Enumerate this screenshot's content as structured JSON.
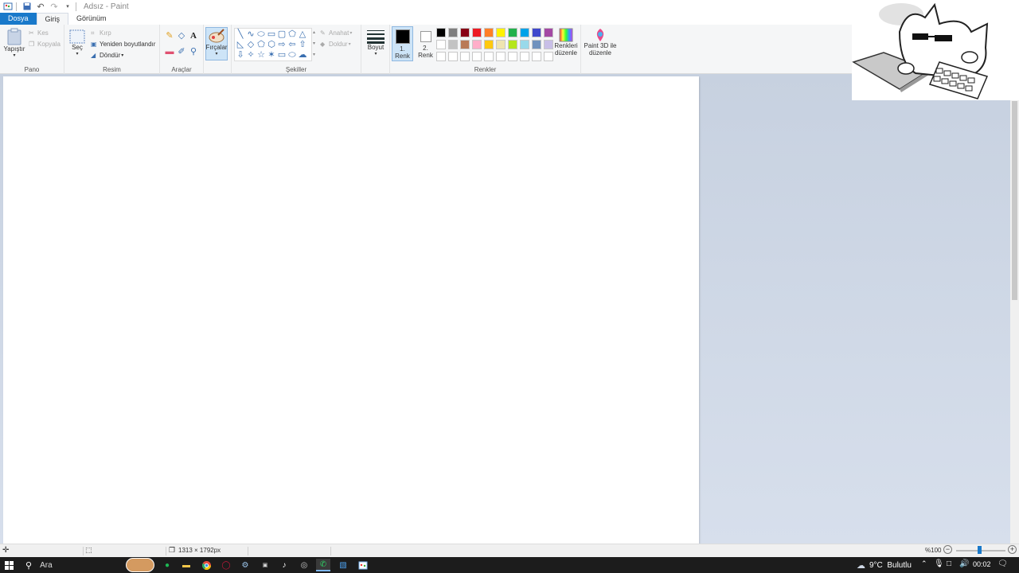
{
  "window": {
    "title": "Adsız - Paint",
    "quick_access": [
      "paint-app-icon",
      "save-icon",
      "undo-icon",
      "redo-icon",
      "customize-dropdown-icon"
    ]
  },
  "tabs": [
    {
      "label": "Dosya",
      "kind": "file"
    },
    {
      "label": "Giriş",
      "kind": "active"
    },
    {
      "label": "Görünüm",
      "kind": "normal"
    }
  ],
  "ribbon": {
    "pano": {
      "label": "Pano",
      "paste": "Yapıştır",
      "cut": "Kes",
      "copy": "Kopyala"
    },
    "resim": {
      "label": "Resim",
      "select": "Seç",
      "crop": "Kırp",
      "resize": "Yeniden boyutlandır",
      "rotate": "Döndür"
    },
    "araclar": {
      "label": "Araçlar"
    },
    "firca": {
      "label": "Fırçalar"
    },
    "sekiller": {
      "label": "Şekiller",
      "outline": "Anahat",
      "fill": "Doldur"
    },
    "boyut": {
      "label": "Boyut"
    },
    "renkler": {
      "label": "Renkler",
      "color1_line1": "1.",
      "color1_line2": "Renk",
      "color2_line1": "2.",
      "color2_line2": "Renk",
      "edit_colors_line1": "Renkleri",
      "edit_colors_line2": "düzenle",
      "paint3d_line1": "Paint 3D ile",
      "paint3d_line2": "düzenle",
      "palette_row1": [
        "#000000",
        "#7f7f7f",
        "#880015",
        "#ed1c24",
        "#ff7f27",
        "#fff200",
        "#22b14c",
        "#00a2e8",
        "#3f48cc",
        "#a349a4"
      ],
      "palette_row2": [
        "#ffffff",
        "#c3c3c3",
        "#b97a57",
        "#ffaec9",
        "#ffc90e",
        "#efe4b0",
        "#b5e61d",
        "#99d9ea",
        "#7092be",
        "#c8bfe7"
      ],
      "palette_row3": [
        "#ffffff",
        "#ffffff",
        "#ffffff",
        "#ffffff",
        "#ffffff",
        "#ffffff",
        "#ffffff",
        "#ffffff",
        "#ffffff",
        "#ffffff"
      ]
    }
  },
  "statusbar": {
    "dimensions": "1313 × 1792px",
    "zoom": "%100"
  },
  "taskbar": {
    "search_label": "Ara",
    "weather": "9°C  Bulutlu",
    "time": "00:02"
  },
  "colors": {
    "accent": "#1979ca",
    "workspace": "#ccd5e3",
    "taskbar": "#1c1c1c"
  }
}
